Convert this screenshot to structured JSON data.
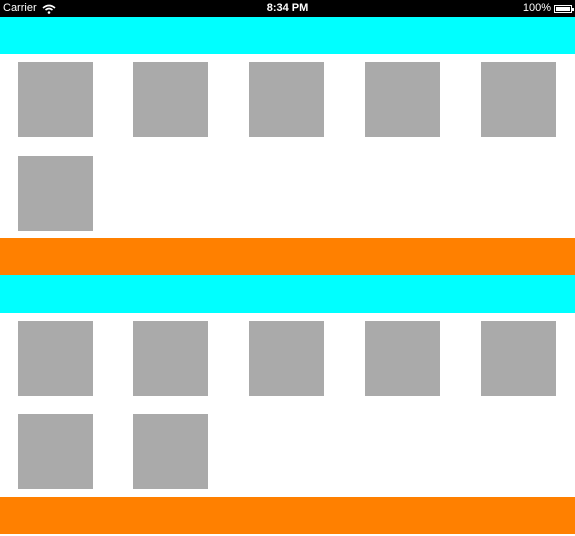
{
  "status_bar": {
    "carrier": "Carrier",
    "time": "8:34 PM",
    "battery": "100%"
  },
  "colors": {
    "header": "#00ffff",
    "footer": "#ff8000",
    "cell": "#aaaaaa",
    "background": "#ffffff",
    "status_bar": "#000000"
  },
  "sections": [
    {
      "cell_count": 6
    },
    {
      "cell_count": 7
    }
  ]
}
